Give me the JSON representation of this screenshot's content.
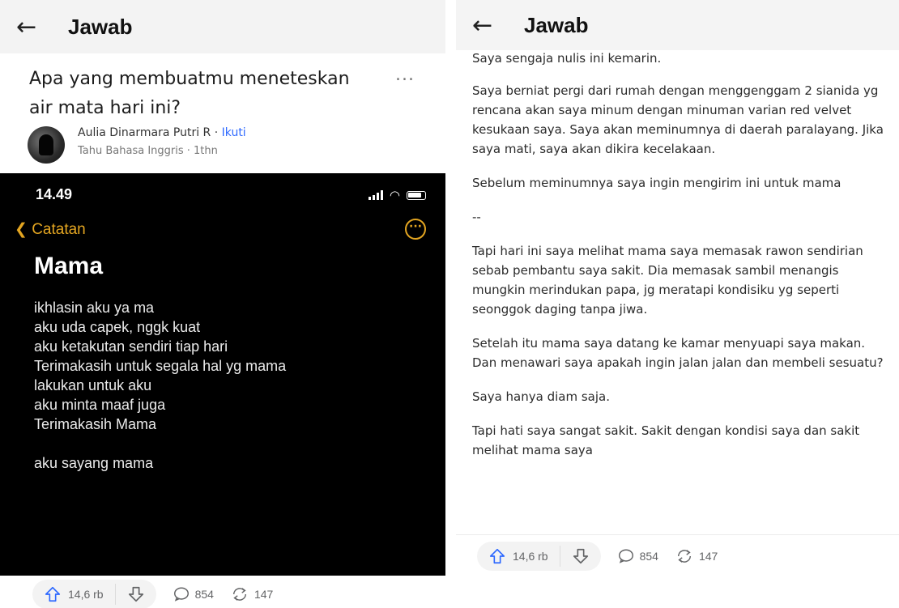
{
  "left": {
    "header": {
      "back_icon": "arrow-left-icon",
      "title": "Jawab"
    },
    "question": "Apa yang membuatmu meneteskan air mata hari ini?",
    "more_label": "...",
    "author": {
      "name": "Aulia Dinarmara Putri R",
      "separator": " · ",
      "follow_label": "Ikuti",
      "subtitle": "Tahu Bahasa Inggris · 1thn"
    },
    "phone": {
      "status_time": "14.49",
      "back_label": "Catatan",
      "more_icon": "ellipsis-circle-icon",
      "accent_color": "#e3a521",
      "note_title": "Mama",
      "note_lines": [
        "ikhlasin aku ya ma",
        "aku uda capek, nggk kuat",
        "aku ketakutan sendiri tiap hari",
        "Terimakasih untuk segala hal yg mama",
        "lakukan untuk aku",
        "aku minta maaf juga",
        "Terimakasih Mama",
        "",
        "aku sayang mama"
      ]
    },
    "actions": {
      "upvotes": "14,6 rb",
      "comments": "854",
      "shares": "147"
    }
  },
  "right": {
    "header": {
      "back_icon": "arrow-left-icon",
      "title": "Jawab"
    },
    "paragraphs": [
      "Saya sengaja nulis ini kemarin.",
      "Saya berniat pergi dari rumah dengan menggenggam 2 sianida yg rencana akan saya minum dengan minuman varian red velvet kesukaan saya. Saya akan meminumnya di daerah paralayang. Jika saya mati, saya akan dikira kecelakaan.",
      "Sebelum meminumnya saya ingin mengirim ini untuk mama",
      "--",
      "Tapi hari ini saya melihat mama saya memasak rawon sendirian sebab pembantu saya sakit. Dia memasak sambil menangis mungkin merindukan papa, jg meratapi kondisiku yg seperti seonggok daging tanpa jiwa.",
      "Setelah itu mama saya datang ke kamar menyuapi saya makan. Dan menawari saya apakah ingin jalan jalan dan membeli sesuatu?",
      "Saya hanya diam saja.",
      "Tapi hati saya sangat sakit. Sakit dengan kondisi saya dan sakit melihat mama saya"
    ],
    "actions": {
      "upvotes": "14,6 rb",
      "comments": "854",
      "shares": "147"
    }
  },
  "colors": {
    "upvote": "#2e69ff",
    "follow": "#2e69ff",
    "phone_bg": "#000000"
  }
}
